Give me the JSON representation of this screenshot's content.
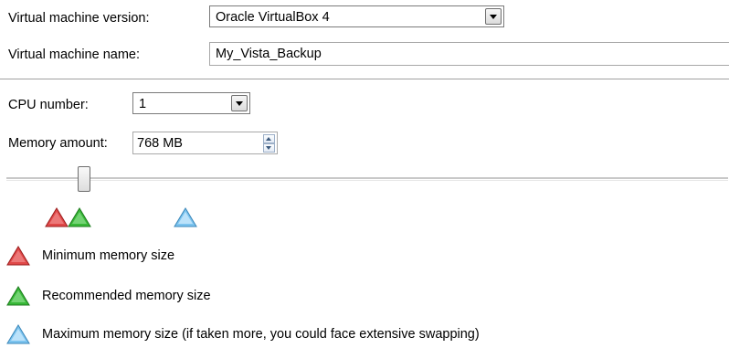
{
  "vm": {
    "version_label": "Virtual machine version:",
    "version_value": "Oracle VirtualBox 4",
    "name_label": "Virtual machine name:",
    "name_value": "My_Vista_Backup"
  },
  "cpu": {
    "label": "CPU number:",
    "value": "1"
  },
  "memory": {
    "label": "Memory amount:",
    "value": "768 MB",
    "slider_fraction": 0.1
  },
  "legend": {
    "minimum": "Minimum memory size",
    "recommended": "Recommended memory size",
    "maximum": "Maximum memory size (if taken more, you could face extensive swapping)"
  },
  "colors": {
    "minimum": "#e04848",
    "recommended": "#38b838",
    "maximum": "#7cc4ef"
  },
  "icons": {
    "minimum": "red-triangle-icon",
    "recommended": "green-triangle-icon",
    "maximum": "blue-triangle-icon"
  }
}
